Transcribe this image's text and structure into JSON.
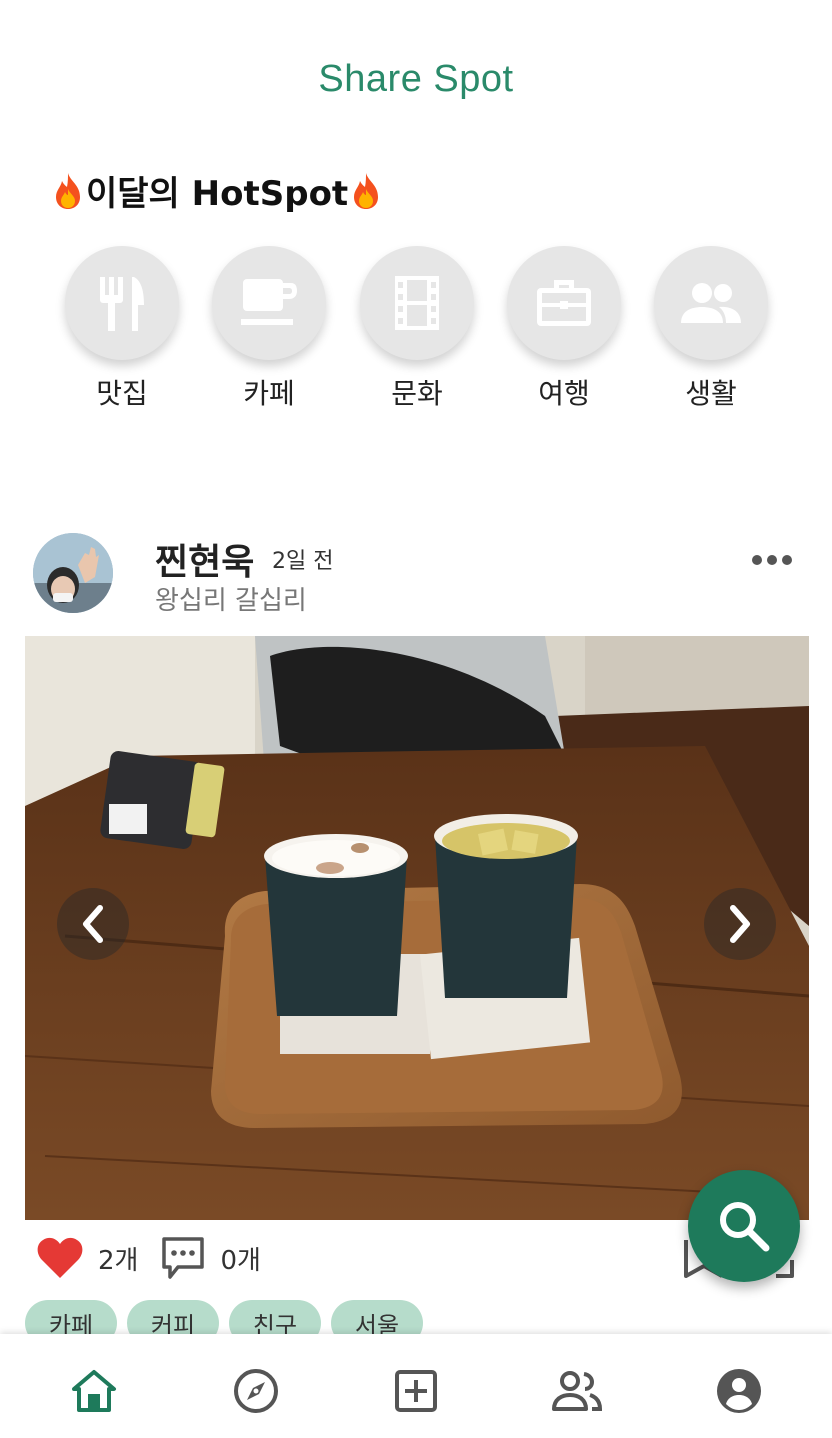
{
  "header": {
    "app_title": "Share Spot"
  },
  "hotspot": {
    "title": "이달의 HotSpot",
    "categories": [
      {
        "label": "맛집",
        "icon": "restaurant-icon"
      },
      {
        "label": "카페",
        "icon": "cafe-icon"
      },
      {
        "label": "문화",
        "icon": "film-icon"
      },
      {
        "label": "여행",
        "icon": "luggage-icon"
      },
      {
        "label": "생활",
        "icon": "people-icon"
      }
    ]
  },
  "post": {
    "author": "찐현욱",
    "time": "2일 전",
    "location": "왕십리 갈십리",
    "likes": "2개",
    "comments": "0개",
    "tags": [
      "카페",
      "커피",
      "친구",
      "서울"
    ]
  },
  "colors": {
    "brand": "#2a8a6a",
    "fab": "#1e7a5b",
    "tag_bg": "#b6dccb",
    "heart": "#e53935"
  }
}
